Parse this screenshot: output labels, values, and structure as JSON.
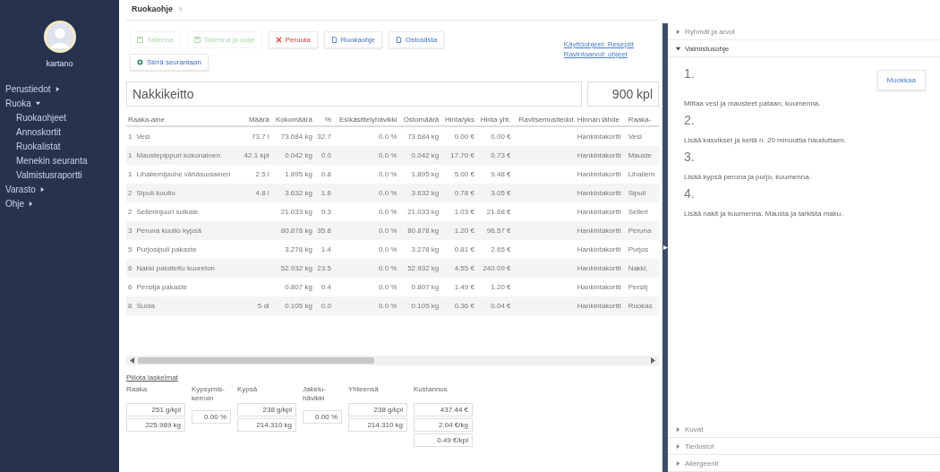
{
  "sidebar": {
    "user": "kartano",
    "items": [
      {
        "label": "Perustiedot",
        "expanded": false
      },
      {
        "label": "Ruoka",
        "expanded": true,
        "children": [
          {
            "label": "Ruokaohjeet"
          },
          {
            "label": "Annoskortit"
          },
          {
            "label": "Ruokalistat"
          },
          {
            "label": "Menekin seuranta"
          },
          {
            "label": "Valmistusraportti"
          }
        ]
      },
      {
        "label": "Varasto",
        "expanded": false
      },
      {
        "label": "Ohje",
        "expanded": false
      }
    ]
  },
  "tabs": [
    {
      "label": "Ruokaohje",
      "close": "×",
      "selected": true
    }
  ],
  "toolbar": {
    "buttons": [
      {
        "label": "Tallenna",
        "kind": "save",
        "disabled": true
      },
      {
        "label": "Tallenna ja sulje",
        "kind": "save",
        "disabled": true
      },
      {
        "label": "Peruuta",
        "kind": "cancel",
        "disabled": false
      },
      {
        "label": "Ruokaohje",
        "kind": "print",
        "disabled": false
      },
      {
        "label": "Ostoslista",
        "kind": "print",
        "disabled": false
      },
      {
        "label": "Siirrä seurantaan",
        "kind": "transfer",
        "disabled": false
      }
    ],
    "links": [
      "Käyttöohjeet: Reseptit",
      "Ravintoarvot: ohjeet"
    ]
  },
  "recipe": {
    "name": "Nakkikeitto",
    "quantity": "900 kpl"
  },
  "table": {
    "columns": [
      "Raaka-aine",
      "Määrä",
      "Kokomäärä",
      "%",
      "Esikäsittelyhävikki",
      "Ostomäärä",
      "Hinta/yks",
      "Hinta yht.",
      "Ravitsemustiedot",
      "Hinnan lähde",
      "Raaka-"
    ],
    "rows": [
      {
        "step": "1",
        "cells": [
          "Vesi",
          "73.7 l",
          "73.684 kg",
          "32.7",
          "0.0 %",
          "73.684 kg",
          "0.00 €",
          "0.00 €",
          "",
          "Hankintakortti",
          "Vesi"
        ]
      },
      {
        "step": "1",
        "cells": [
          "Maustepippuri kokonainen",
          "42.1 kpl",
          "0.042 kg",
          "0.0",
          "0.0 %",
          "0.042 kg",
          "17.70 €",
          "0.73 €",
          "",
          "Hankintakortti",
          "Mauste"
        ]
      },
      {
        "step": "1",
        "cells": [
          "Lihaliemijauhe vähäsuolainen",
          "2.5 l",
          "1.895 kg",
          "0.8",
          "0.0 %",
          "1.895 kg",
          "5.00 €",
          "9.48 €",
          "",
          "Hankintakortti",
          "Lihaliem"
        ]
      },
      {
        "step": "2",
        "cells": [
          "Sipuli kuutio",
          "4.8 l",
          "3.632 kg",
          "1.6",
          "0.0 %",
          "3.632 kg",
          "0.78 €",
          "3.05 €",
          "",
          "Hankintakortti",
          "Sipuli"
        ]
      },
      {
        "step": "2",
        "cells": [
          "Sellerinjuuri suikale",
          "",
          "21.033 kg",
          "9.3",
          "0.0 %",
          "21.033 kg",
          "1.03 €",
          "21.68 €",
          "",
          "Hankintakortti",
          "Selleri"
        ]
      },
      {
        "step": "3",
        "cells": [
          "Peruna kuutio kypsä",
          "",
          "80.878 kg",
          "35.8",
          "0.0 %",
          "80.878 kg",
          "1.20 €",
          "96.57 €",
          "",
          "Hankintakortti",
          "Peruna"
        ]
      },
      {
        "step": "5",
        "cells": [
          "Purjosipuli pakaste",
          "",
          "3.278 kg",
          "1.4",
          "0.0 %",
          "3.278 kg",
          "0.81 €",
          "2.65 €",
          "",
          "Hankintakortti",
          "Purjos"
        ]
      },
      {
        "step": "6",
        "cells": [
          "Nakki paloiteltu kuoreton",
          "",
          "52.932 kg",
          "23.5",
          "0.0 %",
          "52.932 kg",
          "4.55 €",
          "240.09 €",
          "",
          "Hankintakortti",
          "Nakki,"
        ]
      },
      {
        "step": "6",
        "cells": [
          "Persilja pakaste",
          "",
          "0.807 kg",
          "0.4",
          "0.0 %",
          "0.807 kg",
          "1.49 €",
          "1.20 €",
          "",
          "Hankintakortti",
          "Persilj"
        ]
      },
      {
        "step": "8",
        "cells": [
          "Suola",
          "5 dl",
          "0.105 kg",
          "0.0",
          "0.0 %",
          "0.105 kg",
          "0.36 €",
          "0.04 €",
          "",
          "Hankintakortti",
          "Ruokas"
        ]
      }
    ]
  },
  "calculations": {
    "toggle_link": "Piilota laskelmat",
    "groups": [
      {
        "label": "Raaka",
        "kind": "amount",
        "values": [
          "251 g/kpl",
          "225.989 kg"
        ]
      },
      {
        "label": "Kypsymis-kerroin",
        "kind": "factor",
        "values": [
          "0.00 %"
        ]
      },
      {
        "label": "Kypsä",
        "kind": "amount",
        "values": [
          "238 g/kpl",
          "214.310 kg"
        ]
      },
      {
        "label": "Jakelu-hävikki",
        "kind": "factor",
        "values": [
          "0.00 %"
        ]
      },
      {
        "label": "Yhteensä",
        "kind": "amount",
        "values": [
          "238 g/kpl",
          "214.310 kg"
        ]
      },
      {
        "label": "Kustannus",
        "kind": "amount",
        "values": [
          "437.44 €",
          "2.04 €/kg",
          "0.49 €/kpl"
        ]
      }
    ]
  },
  "right_panel": {
    "sections": [
      {
        "title": "Ryhmät ja arvot",
        "expanded": false
      },
      {
        "title": "Valmistusohje",
        "expanded": true,
        "edit_button": "Muokkaa",
        "steps": [
          {
            "number": "1.",
            "text": "Mittaa vesi ja mausteet pataan, kuumenna."
          },
          {
            "number": "2.",
            "text": "Lisää kasvikset ja keitä n. 20 minuuttia hauduttaen."
          },
          {
            "number": "3.",
            "text": "Lisää kypsä peruna ja purjo, kuumenna."
          },
          {
            "number": "4.",
            "text": "Lisää nakit ja kuumenna. Mausta ja tarkista maku."
          }
        ]
      },
      {
        "title": "Kuvat",
        "expanded": false
      },
      {
        "title": "Tiedostot",
        "expanded": false
      },
      {
        "title": "Allergeenit",
        "expanded": false
      }
    ]
  }
}
